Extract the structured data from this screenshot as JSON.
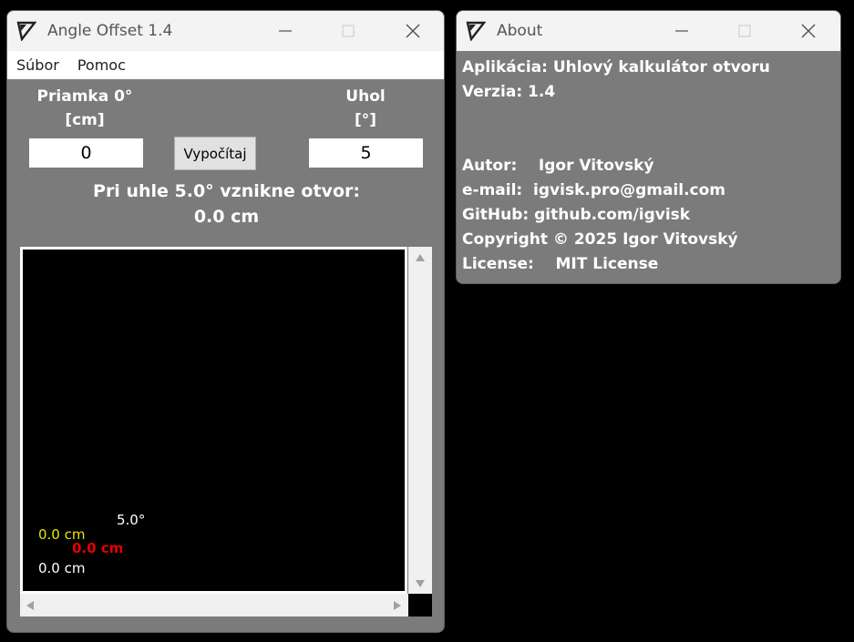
{
  "main_window": {
    "title": "Angle Offset 1.4",
    "menu": [
      "Súbor",
      "Pomoc"
    ],
    "line_label": "Priamka 0°",
    "line_unit": "[cm]",
    "angle_label": "Uhol",
    "angle_unit": "[°]",
    "line_value": "0",
    "angle_value": "5",
    "calc_button": "Vypočítaj",
    "result_line1": "Pri uhle 5.0° vznikne otvor:",
    "result_line2": "0.0 cm",
    "canvas": {
      "angle_label": "5.0°",
      "yellow_label": "0.0 cm",
      "red_label": "0.0 cm",
      "white_label": "0.0 cm",
      "colors": {
        "angle": "#ffffff",
        "yellow": "#e6e600",
        "red": "#e60000",
        "white": "#ffffff"
      }
    }
  },
  "about_window": {
    "title": "About",
    "lines": [
      "Aplikácia: Uhlový kalkulátor otvoru",
      "Verzia: 1.4",
      "Autor:    Igor Vitovský",
      "e-mail:  igvisk.pro@gmail.com",
      "GitHub: github.com/igvisk",
      "Copyright © 2025 Igor Vitovský",
      "License:    MIT License"
    ]
  },
  "icons": {
    "app": "angle-app-icon",
    "minimize": "minimize-icon",
    "maximize": "maximize-icon",
    "close": "close-icon"
  }
}
